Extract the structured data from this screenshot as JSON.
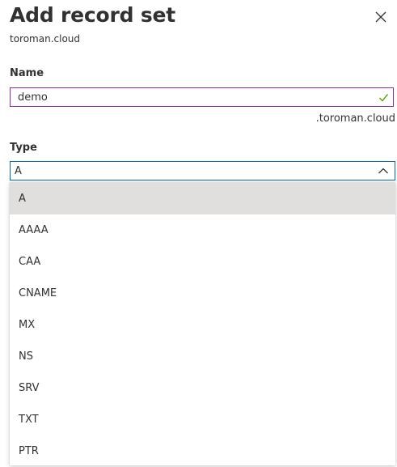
{
  "panel": {
    "title": "Add record set",
    "subtitle": "toroman.cloud"
  },
  "name_field": {
    "label": "Name",
    "value": "demo",
    "suffix": ".toroman.cloud",
    "valid": true
  },
  "type_field": {
    "label": "Type",
    "selected": "A",
    "expanded": true,
    "options": [
      "A",
      "AAAA",
      "CAA",
      "CNAME",
      "MX",
      "NS",
      "SRV",
      "TXT",
      "PTR"
    ]
  },
  "icons": {
    "close": "close-icon",
    "valid": "checkmark-icon",
    "dropdown": "chevron-up-icon"
  },
  "colors": {
    "name_input_border": "#8a2da5",
    "select_border": "#0067b8",
    "valid_check": "#57a300",
    "selected_option_bg": "#e1dfdd"
  }
}
